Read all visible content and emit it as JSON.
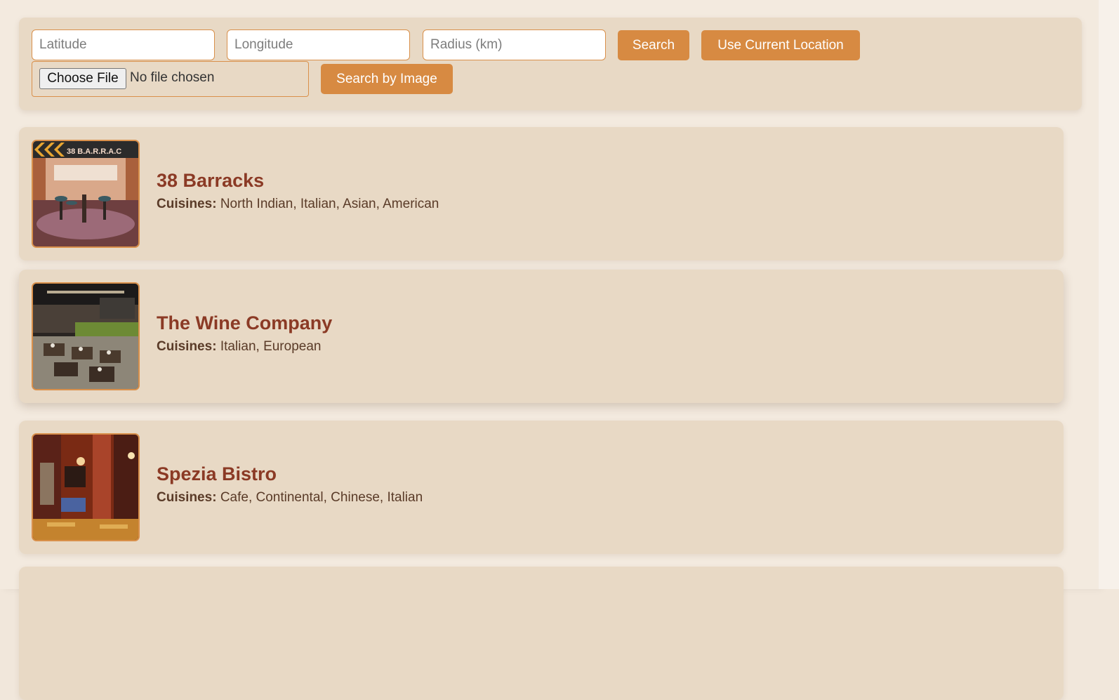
{
  "search": {
    "latitude_placeholder": "Latitude",
    "longitude_placeholder": "Longitude",
    "radius_placeholder": "Radius (km)",
    "search_label": "Search",
    "current_location_label": "Use Current Location",
    "choose_file_label": "Choose File",
    "file_status": "No file chosen",
    "search_by_image_label": "Search by Image"
  },
  "cuisines_label": "Cuisines:",
  "restaurants": [
    {
      "name": "38 Barracks",
      "cuisines": "North Indian, Italian, Asian, American",
      "image_sign": "38 B.A.R.R.A.C"
    },
    {
      "name": "The Wine Company",
      "cuisines": "Italian, European"
    },
    {
      "name": "Spezia Bistro",
      "cuisines": "Cafe, Continental, Chinese, Italian"
    }
  ],
  "colors": {
    "accent": "#d78a42",
    "card_bg": "#e8d9c5",
    "page_bg": "#f3eadf",
    "title": "#8b3a25"
  }
}
